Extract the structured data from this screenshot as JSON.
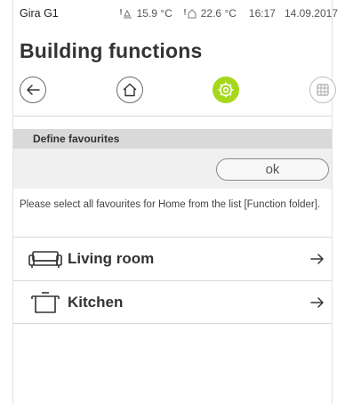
{
  "status": {
    "device_name": "Gira G1",
    "outdoor_temp": "15.9 °C",
    "indoor_temp": "22.6 °C",
    "time": "16:17",
    "date": "14.09.2017"
  },
  "page": {
    "title": "Building functions"
  },
  "navbar": {
    "icons": [
      "back-arrow-icon",
      "home-icon",
      "gear-icon",
      "grid-icon"
    ],
    "accent_color": "#a6d81a"
  },
  "favourites": {
    "section_title": "Define favourites",
    "ok_label": "ok",
    "hint": "Please select all favourites for Home from the list [Function folder]."
  },
  "list": {
    "items": [
      {
        "label": "Living room",
        "icon": "sofa-icon"
      },
      {
        "label": "Kitchen",
        "icon": "cooking-pot-icon"
      }
    ]
  }
}
